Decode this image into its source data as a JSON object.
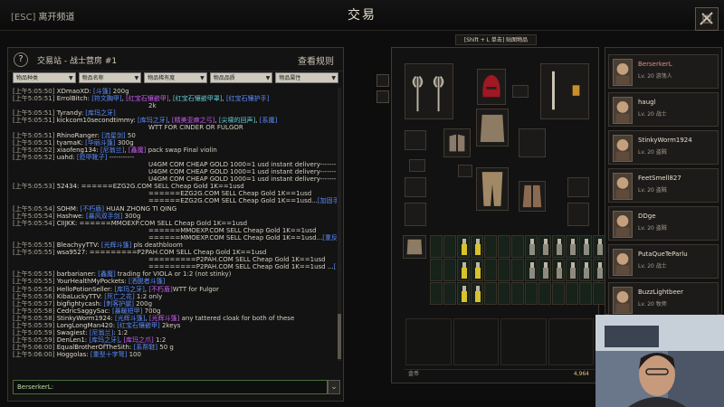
{
  "topbar": {
    "esc_key": "[ESC]",
    "esc_label": "离开频道",
    "title": "交易"
  },
  "trade": {
    "help": "?",
    "channel_title": "交易站 - 战士营房 #1",
    "rules": "查看规则",
    "filters": [
      "物品种类",
      "物品名称",
      "物品稀有度",
      "物品品质",
      "物品属性"
    ],
    "input_name": "BerserkerL:",
    "send": "⌄"
  },
  "chat": [
    {
      "ts": "[上午5:05:50]",
      "user": "XDmaoXD:",
      "msg": "[斗篷] 200g"
    },
    {
      "ts": "[上午5:05:51]",
      "user": "ErrolBitch:",
      "msg": "[符文胸甲], [红宝石镶嵌甲], [红宝石镶嵌甲罩], [红宝石镶护手]"
    },
    {
      "ts": "",
      "user": "",
      "msg": "2k"
    },
    {
      "ts": "[上午5:05:51]",
      "user": "Tyrandy:",
      "msg": "[库玛之牙]"
    },
    {
      "ts": "[上午5:05:51]",
      "user": "kickcom10secondtimmy:",
      "msg": "[库玛之牙], [精美亚麻之弓], [尖啸的回声], [系魔]"
    },
    {
      "ts": "",
      "user": "",
      "msg": "WTT FOR CINDER OR FULGOR"
    },
    {
      "ts": "[上午5:05:51]",
      "user": "RhinoRanger:",
      "msg": "[流星剑] 50"
    },
    {
      "ts": "[上午5:05:51]",
      "user": "tyamaK:",
      "msg": "[华丽斗篷] 300g"
    },
    {
      "ts": "[上午5:05:52]",
      "user": "xiaofeng134:",
      "msg": "[尼翁兰], [鑫魔] pack swap Final violin"
    },
    {
      "ts": "[上午5:05:52]",
      "user": "uahd:",
      "msg": "[贬甲靴子] -----------"
    },
    {
      "ts": "",
      "user": "",
      "msg": "U4GM COM CHEAP GOLD 1000=1 usd instant delivery-------"
    },
    {
      "ts": "",
      "user": "",
      "msg": "U4GM COM CHEAP GOLD 1000=1 usd instant delivery-------"
    },
    {
      "ts": "",
      "user": "",
      "msg": "U4GM COM CHEAP GOLD 1000=1 usd instant delivery-------"
    },
    {
      "ts": "[上午5:05:53]",
      "user": "52434:",
      "msg": "======EZG2G.COM  SELL Cheap Gold 1K==1usd"
    },
    {
      "ts": "",
      "user": "",
      "msg": "======EZG2G.COM  SELL Cheap Gold 1K==1usd"
    },
    {
      "ts": "",
      "user": "",
      "msg": "======EZG2G.COM  SELL Cheap Gold 1K==1usd...[加固手套]"
    },
    {
      "ts": "[上午5:05:54]",
      "user": "SOHM:",
      "msg": "[不朽盾] HUAN ZHONG TI QING"
    },
    {
      "ts": "[上午5:05:54]",
      "user": "Hashwe:",
      "msg": "[暴风双手剑] 300g"
    },
    {
      "ts": "[上午5:05:54]",
      "user": "CIIJKK:",
      "msg": "======MMOEXP.COM  SELL Cheap Gold 1K==1usd"
    },
    {
      "ts": "",
      "user": "",
      "msg": "======MMOEXP.COM  SELL Cheap Gold 1K==1usd"
    },
    {
      "ts": "",
      "user": "",
      "msg": "======MMOEXP.COM  SELL Cheap Gold 1K==1usd...[重反护腿]"
    },
    {
      "ts": "[上午5:05:55]",
      "user": "BleachyyTTV:",
      "msg": "[光辉斗篷] pls deathbloom"
    },
    {
      "ts": "[上午5:05:55]",
      "user": "wsa9527:",
      "msg": "=========P2PAH.COM  SELL Cheap Gold 1K==1usd"
    },
    {
      "ts": "",
      "user": "",
      "msg": "=========P2PAH.COM  SELL Cheap Gold 1K==1usd"
    },
    {
      "ts": "",
      "user": "",
      "msg": "=========P2PAH.COM  SELL Cheap Gold 1K==1usd ...[坚固的靴子]"
    },
    {
      "ts": "[上午5:05:55]",
      "user": "barbarianer:",
      "msg": "[鑫魔] trading for VIOLA or 1:2 (not stinky)"
    },
    {
      "ts": "[上午5:05:55]",
      "user": "YourHealthMyPockets:",
      "msg": "[洒脱者斗篷]"
    },
    {
      "ts": "[上午5:05:56]",
      "user": "HelloPotionSeller:",
      "msg": "[库玛之牙], [不朽盾]WTT for Fulgor"
    },
    {
      "ts": "[上午5:05:56]",
      "user": "KibaLuckyTTV:",
      "msg": "[死亡之花] 1:2 only"
    },
    {
      "ts": "[上午5:05:57]",
      "user": "bigfightycash:",
      "msg": "[刺客护腿] 200g"
    },
    {
      "ts": "[上午5:05:58]",
      "user": "CedricSaggySac:",
      "msg": "[暴暖短甲] 700g"
    },
    {
      "ts": "[上午5:05:58]",
      "user": "StinkyWorm1924:",
      "msg": "[光辉斗篷], [光辉斗篷] any tattered cloak for both of these"
    },
    {
      "ts": "[上午5:05:59]",
      "user": "LongLongMan420:",
      "msg": "[红宝石镶嵌甲] 2keys"
    },
    {
      "ts": "[上午5:05:59]",
      "user": "Swagiest:",
      "msg": "[尼翁兰]: 1:2"
    },
    {
      "ts": "[上午5:05:59]",
      "user": "DenLen1:",
      "msg": "[库玛之牙], [库玛之爪] 1:2"
    },
    {
      "ts": "[上午5:06:00]",
      "user": "EqualBrotherOfTheSith:",
      "msg": "[系帮鞋] 50 g"
    },
    {
      "ts": "[上午5:06:00]",
      "user": "Hoggolas:",
      "msg": "[重型十字弩] 100"
    }
  ],
  "inventory": {
    "hint": "[Shift + L 单击] 贴图物品",
    "gold_label": "金币",
    "gold_value": "4,964"
  },
  "party": [
    {
      "name": "BerserkerL",
      "level": "Lv. 20 游荡人"
    },
    {
      "name": "haugl",
      "level": "Lv. 20 战士"
    },
    {
      "name": "StinkyWorm1924",
      "level": "Lv. 20 盗贼"
    },
    {
      "name": "FeetSmell827",
      "level": "Lv. 20 盗贼"
    },
    {
      "name": "DDge",
      "level": "Lv. 20 盗贼"
    },
    {
      "name": "PutaQueTeParlu",
      "level": "Lv. 20 战士"
    },
    {
      "name": "BuzzLightbeer",
      "level": "Lv. 20 牧师"
    }
  ],
  "colors": {
    "gold": "#e7c66a",
    "blue_link": "#5a8dff",
    "purple_link": "#c65cf0",
    "self_name": "#e58a7a"
  }
}
